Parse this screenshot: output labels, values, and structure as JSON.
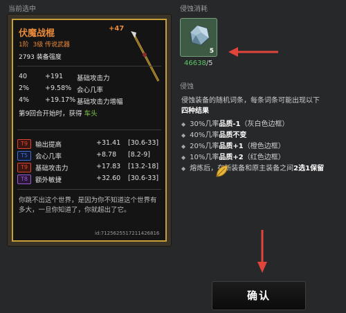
{
  "left_panel": {
    "title": "当前选中",
    "item": {
      "name": "伏魔战棍",
      "level": "+47",
      "tier": "1阶",
      "grade": "3级 传说武器",
      "power": "2793 装备强度",
      "base_stats": [
        {
          "value": "40",
          "bonus": "+191",
          "label": "基础攻击力"
        },
        {
          "value": "2%",
          "bonus": "+9.58%",
          "label": "会心几率"
        },
        {
          "value": "4%",
          "bonus": "+19.17%",
          "label": "基础攻击力增幅"
        }
      ],
      "special_prefix": "第9回合开始时，获得",
      "special_keyword": "车头",
      "affixes": [
        {
          "tier": "T9",
          "tier_color": "#e0462d",
          "label": "输出提高",
          "value": "+31.41",
          "range": "[30.6-33]"
        },
        {
          "tier": "T5",
          "tier_color": "#3f6fd8",
          "label": "会心几率",
          "value": "+8.78",
          "range": "[8.2-9]"
        },
        {
          "tier": "T9",
          "tier_color": "#e0462d",
          "label": "基础攻击力",
          "value": "+17.83",
          "range": "[13.2-18]"
        },
        {
          "tier": "T8",
          "tier_color": "#9b59d6",
          "label": "额外敏捷",
          "value": "+32.60",
          "range": "[30.6-33]"
        }
      ],
      "flavor_text": "你跳不出这个世界，是因为你不知道这个世界有多大，一旦你知道了，你就超出了它。",
      "item_id": "id:71256255172114268​16"
    }
  },
  "right_panel": {
    "cost_title": "侵蚀消耗",
    "cost": {
      "icon": "ore-crystal-icon",
      "slot_count": "5",
      "have": "46638",
      "need": "/5"
    },
    "erosion_title": "侵蚀",
    "erosion_desc": "侵蚀装备的随机词条，每条词条可能出现以下",
    "erosion_desc_bold": "四种结果",
    "outcomes": [
      {
        "prefix": "30%几率",
        "bold": "品质-1",
        "suffix": "（灰白色边框）"
      },
      {
        "prefix": "40%几率",
        "bold": "品质不变",
        "suffix": ""
      },
      {
        "prefix": "20%几率",
        "bold": "品质+1",
        "suffix": "（橙色边框）"
      },
      {
        "prefix": "10%几率",
        "bold": "品质+2",
        "suffix": "（红色边框）"
      },
      {
        "prefix": "熔炼后，在新装备和原主装备之间",
        "bold": "2选1保留",
        "suffix": ""
      }
    ],
    "confirm_label": "确认"
  },
  "colors": {
    "accent_gold": "#c9a037",
    "item_orange": "#e98a3a",
    "stat_green": "#7ecb4a",
    "arrow_red": "#e0443a"
  }
}
